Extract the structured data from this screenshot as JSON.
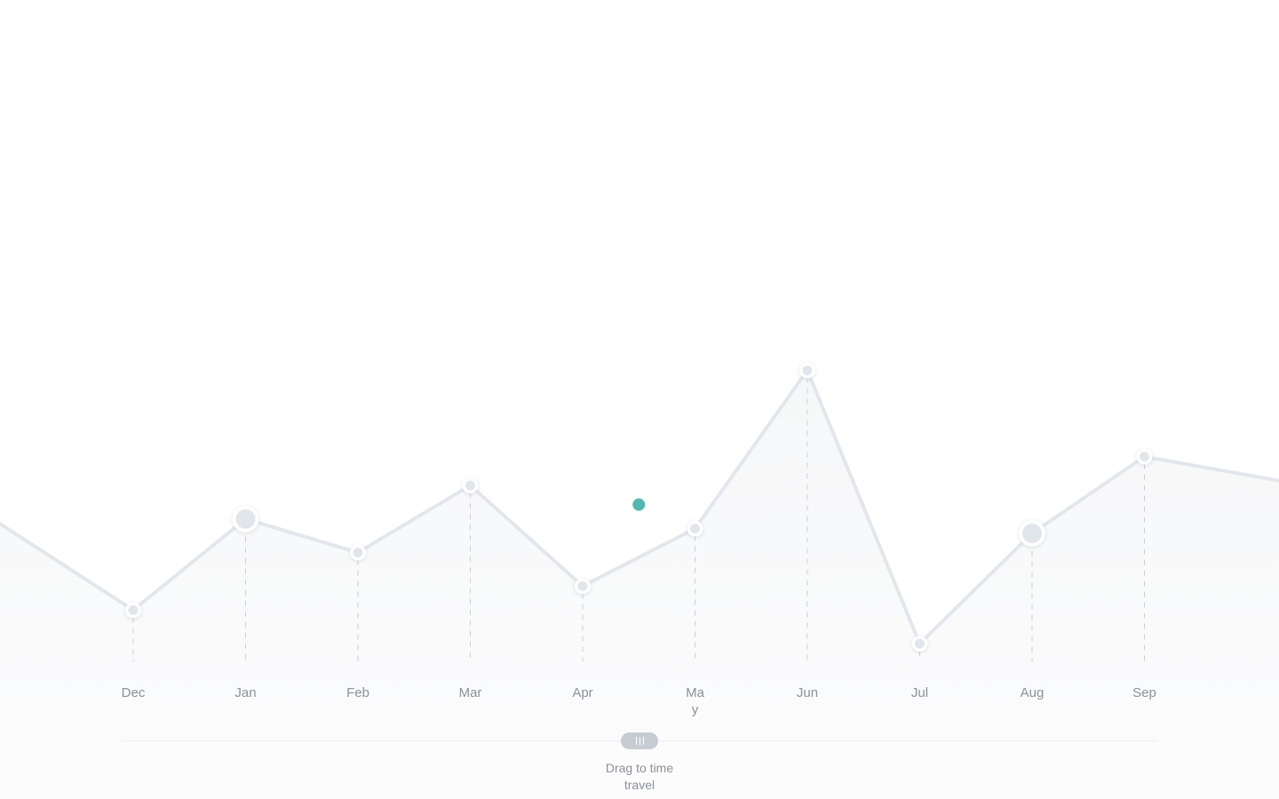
{
  "chart_data": {
    "type": "area",
    "categories": [
      "Dec",
      "Jan",
      "Feb",
      "Mar",
      "Apr",
      "May",
      "Jun",
      "Jul",
      "Aug",
      "Sep"
    ],
    "values": [
      32,
      51,
      44,
      58,
      37,
      49,
      82,
      25,
      48,
      64
    ],
    "leading_value": 50,
    "trailing_value": 59,
    "highlighted_points": [
      "Jan",
      "Aug"
    ],
    "cursor": {
      "between": [
        "Apr",
        "May"
      ],
      "position": 0.5,
      "value": 54,
      "color": "#4fb9ad"
    },
    "ylim": [
      0,
      100
    ],
    "grid": false,
    "colors": {
      "line": "#e2e7ec",
      "area": "#f8f9fa",
      "cursor": "#4fb9ad"
    }
  },
  "scrubber": {
    "caption": "Drag to time travel",
    "handle_icon": "grip-lines-icon"
  }
}
